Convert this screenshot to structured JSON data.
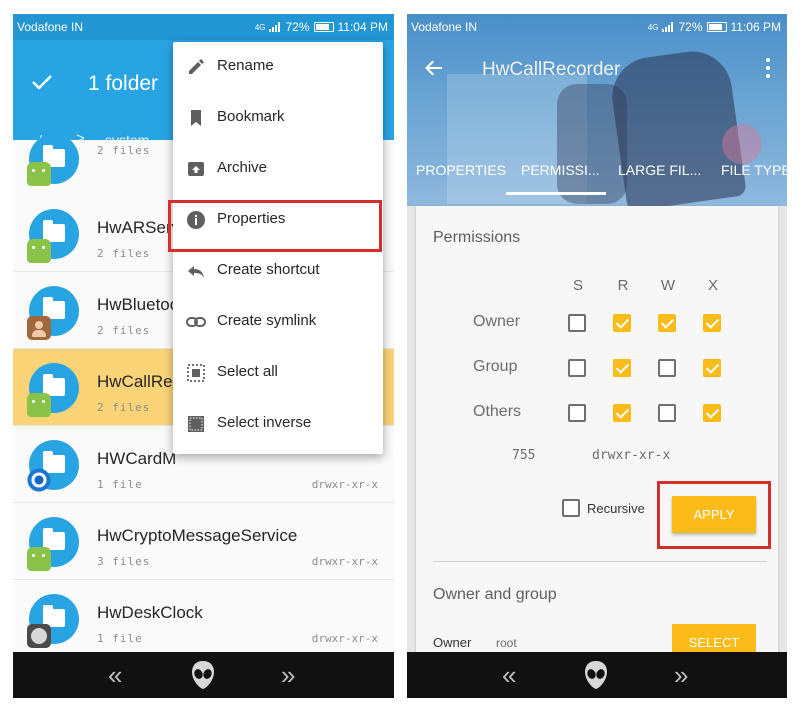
{
  "left": {
    "status": {
      "carrier": "Vodafone IN",
      "network": "4G",
      "battery": "72%",
      "time": "11:04 PM"
    },
    "toolbar": {
      "title": "1 folder"
    },
    "breadcrumb": {
      "root": "/",
      "chevron": ">",
      "current": "system"
    },
    "files": [
      {
        "name": "",
        "count": "2 files",
        "perm": "",
        "badge": "android",
        "selected": false
      },
      {
        "name": "HwARServ",
        "count": "2 files",
        "perm": "",
        "badge": "android",
        "selected": false
      },
      {
        "name": "HwBluetoo",
        "count": "2 files",
        "perm": "",
        "badge": "contacts",
        "selected": false
      },
      {
        "name": "HwCallRec",
        "count": "2 files",
        "perm": "",
        "badge": "android",
        "selected": true
      },
      {
        "name": "HWCardM",
        "count": "1 file",
        "perm": "drwxr-xr-x",
        "badge": "gear",
        "selected": false
      },
      {
        "name": "HwCryptoMessageService",
        "count": "3 files",
        "perm": "drwxr-xr-x",
        "badge": "android",
        "selected": false
      },
      {
        "name": "HwDeskClock",
        "count": "1 file",
        "perm": "drwxr-xr-x",
        "badge": "clock",
        "selected": false
      }
    ],
    "menu": {
      "items": [
        {
          "label": "Rename",
          "icon": "pencil-icon"
        },
        {
          "label": "Bookmark",
          "icon": "bookmark-icon"
        },
        {
          "label": "Archive",
          "icon": "archive-icon"
        },
        {
          "label": "Properties",
          "icon": "info-icon"
        },
        {
          "label": "Create shortcut",
          "icon": "reply-arrow-icon"
        },
        {
          "label": "Create symlink",
          "icon": "link-icon"
        },
        {
          "label": "Select all",
          "icon": "select-all-icon"
        },
        {
          "label": "Select inverse",
          "icon": "select-inverse-icon"
        }
      ],
      "highlighted": "Properties"
    }
  },
  "right": {
    "status": {
      "carrier": "Vodafone IN",
      "network": "4G",
      "battery": "72%",
      "time": "11:06 PM"
    },
    "header": {
      "title": "HwCallRecorder"
    },
    "tabs": [
      "PROPERTIES",
      "PERMISSI...",
      "LARGE FIL...",
      "FILE TYPES"
    ],
    "active_tab": "PERMISSI...",
    "permissions": {
      "heading": "Permissions",
      "columns": [
        "S",
        "R",
        "W",
        "X"
      ],
      "rows": [
        {
          "label": "Owner",
          "checks": [
            false,
            true,
            true,
            true
          ]
        },
        {
          "label": "Group",
          "checks": [
            false,
            true,
            false,
            true
          ]
        },
        {
          "label": "Others",
          "checks": [
            false,
            true,
            false,
            true
          ]
        }
      ],
      "octal": "755",
      "symbolic": "drwxr-xr-x",
      "recursive_label": "Recursive",
      "recursive_checked": false,
      "apply_label": "APPLY"
    },
    "owner_group": {
      "heading": "Owner and group",
      "owner_label": "Owner",
      "owner_value": "root",
      "select_label": "SELECT"
    }
  },
  "colors": {
    "toolbar_blue": "#29a4e3",
    "accent_amber": "#fbbc1a",
    "selected_row": "#fbd478",
    "highlight_red": "#d32f2f",
    "navbar": "#111111"
  }
}
